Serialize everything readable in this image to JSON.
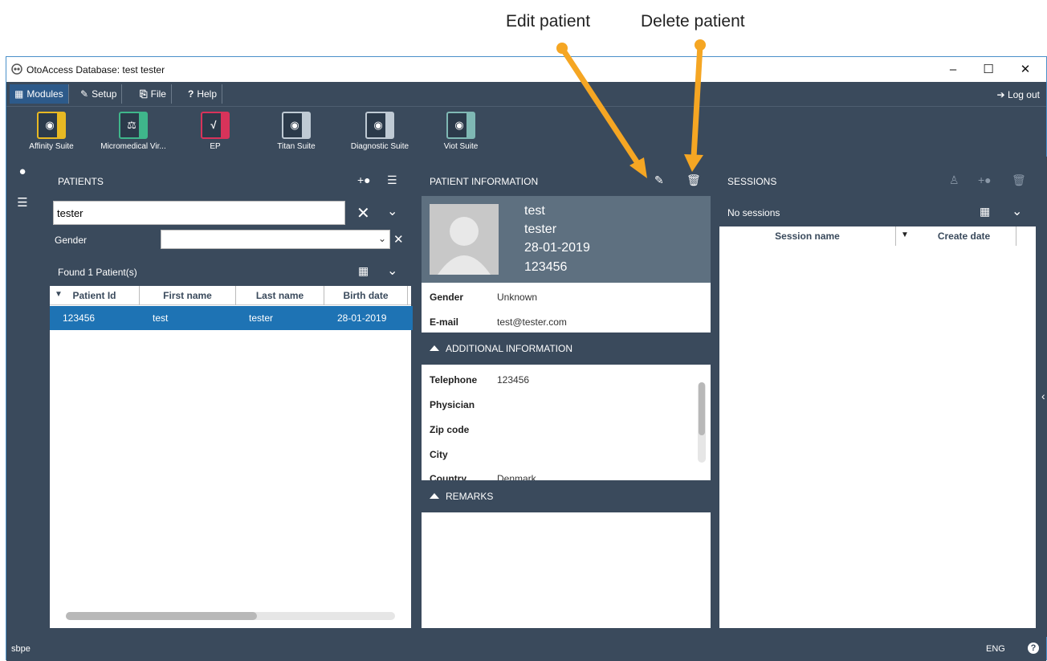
{
  "annotations": {
    "edit_callout": "Edit patient",
    "delete_callout": "Delete patient"
  },
  "window": {
    "title": "OtoAccess Database: test tester",
    "minimize": "–",
    "maximize": "☐",
    "close": "✕"
  },
  "menu": {
    "modules": "Modules",
    "setup": "Setup",
    "file": "File",
    "help": "Help",
    "logout": "Log out"
  },
  "modules": [
    {
      "label": "Affinity Suite",
      "color": "#e8b923"
    },
    {
      "label": "Micromedical Vir...",
      "color": "#3fb68b"
    },
    {
      "label": "EP",
      "color": "#d8335a"
    },
    {
      "label": "Titan Suite",
      "color": "#bfcad4"
    },
    {
      "label": "Diagnostic Suite",
      "color": "#bfcad4"
    },
    {
      "label": "Viot Suite",
      "color": "#7fb8b4"
    }
  ],
  "patients": {
    "title": "PATIENTS",
    "search_value": "tester",
    "gender_label": "Gender",
    "gender_value": "",
    "found_label": "Found 1 Patient(s)",
    "columns": [
      "Patient Id",
      "First name",
      "Last name",
      "Birth date"
    ],
    "rows": [
      {
        "id": "123456",
        "first": "test",
        "last": "tester",
        "birth": "28-01-2019"
      }
    ]
  },
  "patient_info": {
    "title": "PATIENT INFORMATION",
    "first_name": "test",
    "last_name": "tester",
    "birth_date": "28-01-2019",
    "patient_id": "123456",
    "fields": [
      {
        "label": "Gender",
        "value": "Unknown"
      },
      {
        "label": "E-mail",
        "value": "test@tester.com"
      }
    ],
    "additional_title": "ADDITIONAL INFORMATION",
    "additional_fields": [
      {
        "label": "Telephone",
        "value": "123456"
      },
      {
        "label": "Physician",
        "value": ""
      },
      {
        "label": "Zip code",
        "value": ""
      },
      {
        "label": "City",
        "value": ""
      },
      {
        "label": "Country",
        "value": "Denmark"
      }
    ],
    "remarks_title": "REMARKS"
  },
  "sessions": {
    "title": "SESSIONS",
    "subtitle": "No sessions",
    "columns": [
      "Session name",
      "Create date"
    ]
  },
  "status": {
    "user": "sbpe",
    "language": "ENG",
    "help": "?"
  },
  "colors": {
    "dark": "#3a4a5c",
    "accent": "#1e73b4",
    "arrow": "#f5a623"
  }
}
